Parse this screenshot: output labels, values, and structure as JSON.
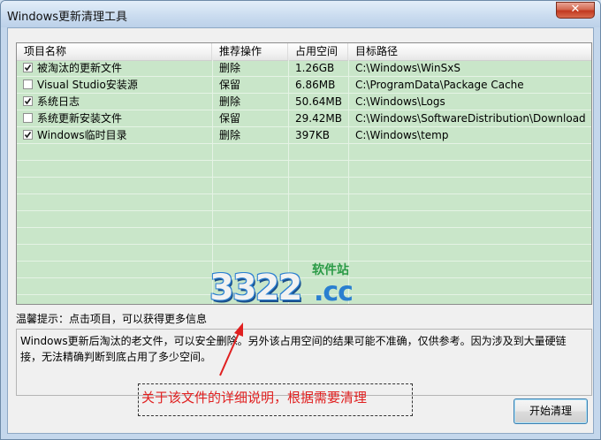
{
  "window": {
    "title": "Windows更新清理工具",
    "close_symbol": "✕"
  },
  "list": {
    "columns": [
      "项目名称",
      "推荐操作",
      "占用空间",
      "目标路径"
    ],
    "rows": [
      {
        "checked": true,
        "name": "被淘汰的更新文件",
        "action": "删除",
        "size": "1.26GB",
        "path": "C:\\Windows\\WinSxS"
      },
      {
        "checked": false,
        "name": "Visual Studio安装源",
        "action": "保留",
        "size": "6.86MB",
        "path": "C:\\ProgramData\\Package Cache"
      },
      {
        "checked": true,
        "name": "系统日志",
        "action": "删除",
        "size": "50.64MB",
        "path": "C:\\Windows\\Logs"
      },
      {
        "checked": false,
        "name": "系统更新安装文件",
        "action": "保留",
        "size": "29.42MB",
        "path": "C:\\Windows\\SoftwareDistribution\\Download"
      },
      {
        "checked": true,
        "name": "Windows临时目录",
        "action": "删除",
        "size": "397KB",
        "path": "C:\\Windows\\temp"
      }
    ],
    "row_color": "#c9e6c9"
  },
  "hint": {
    "text": "温馨提示：点击项目，可以获得更多信息"
  },
  "description": {
    "text": "Windows更新后淘汰的老文件，可以安全删除。另外该占用空间的结果可能不准确，仅供参考。因为涉及到大量硬链接，无法精确判断到底占用了多少空间。"
  },
  "buttons": {
    "start_label": "开始清理"
  },
  "annotation": {
    "text": "关于该文件的详细说明，根据需要清理",
    "color": "#e02020"
  },
  "watermark": {
    "main": "3322",
    "cc": ".cc",
    "sub": "软件站"
  }
}
